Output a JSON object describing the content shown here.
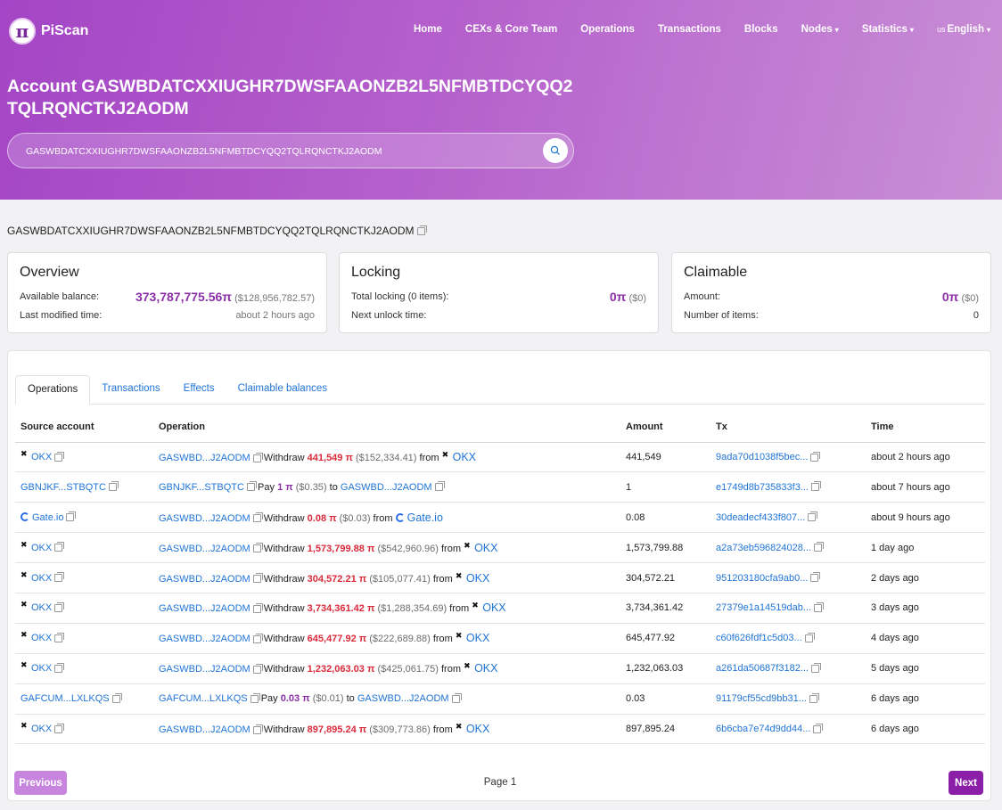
{
  "header": {
    "logo_symbol": "π",
    "logo_text": "PiScan",
    "nav": [
      {
        "label": "Home",
        "caret": ""
      },
      {
        "label": "CEXs & Core Team",
        "caret": ""
      },
      {
        "label": "Operations",
        "caret": ""
      },
      {
        "label": "Transactions",
        "caret": ""
      },
      {
        "label": "Blocks",
        "caret": ""
      },
      {
        "label": "Nodes",
        "caret": "▾"
      },
      {
        "label": "Statistics",
        "caret": "▾"
      },
      {
        "label": "English",
        "flag": "us",
        "caret": "▾"
      }
    ],
    "title": "Account GASWBDATCXXIUGHR7DWSFAAONZB2L5NFMBTDCYQQ2TQLRQNCTKJ2AODM",
    "search_value": "GASWBDATCXXIUGHR7DWSFAAONZB2L5NFMBTDCYQQ2TQLRQNCTKJ2AODM"
  },
  "account_address": "GASWBDATCXXIUGHR7DWSFAAONZB2L5NFMBTDCYQQ2TQLRQNCTKJ2AODM",
  "overview": {
    "title": "Overview",
    "balance_label": "Available balance:",
    "balance": "373,787,775.56π",
    "balance_usd": "($128,956,782.57)",
    "modified_label": "Last modified time:",
    "modified": "about 2 hours ago"
  },
  "locking": {
    "title": "Locking",
    "total_label": "Total locking (0 items):",
    "total": "0π",
    "total_usd": "($0)",
    "unlock_label": "Next unlock time:",
    "unlock": ""
  },
  "claimable": {
    "title": "Claimable",
    "amount_label": "Amount:",
    "amount": "0π",
    "amount_usd": "($0)",
    "items_label": "Number of items:",
    "items": "0"
  },
  "tabs": [
    "Operations",
    "Transactions",
    "Effects",
    "Claimable balances"
  ],
  "table": {
    "headers": [
      "Source account",
      "Operation",
      "Amount",
      "Tx",
      "Time"
    ],
    "rows": [
      {
        "source": "OKX",
        "op_src": "GASWBD...J2AODM",
        "verb": "Withdraw",
        "amt": "441,549",
        "usd": "($152,334.41)",
        "prep": "from",
        "target": "OKX",
        "amount": "441,549",
        "tx": "9ada70d1038f5bec...",
        "time": "about 2 hours ago"
      },
      {
        "source": "GBNJKF...STBQTC",
        "op_src": "GBNJKF...STBQTC",
        "verb": "Pay",
        "amt": "1",
        "usd": "($0.35)",
        "prep": "to",
        "target": "GASWBD...J2AODM",
        "amount": "1",
        "tx": "e1749d8b735833f3...",
        "time": "about 7 hours ago"
      },
      {
        "source": "Gate.io",
        "op_src": "GASWBD...J2AODM",
        "verb": "Withdraw",
        "amt": "0.08",
        "usd": "($0.03)",
        "prep": "from",
        "target": "Gate.io",
        "amount": "0.08",
        "tx": "30deadecf433f807...",
        "time": "about 9 hours ago"
      },
      {
        "source": "OKX",
        "op_src": "GASWBD...J2AODM",
        "verb": "Withdraw",
        "amt": "1,573,799.88",
        "usd": "($542,960.96)",
        "prep": "from",
        "target": "OKX",
        "amount": "1,573,799.88",
        "tx": "a2a73eb596824028...",
        "time": "1 day ago"
      },
      {
        "source": "OKX",
        "op_src": "GASWBD...J2AODM",
        "verb": "Withdraw",
        "amt": "304,572.21",
        "usd": "($105,077.41)",
        "prep": "from",
        "target": "OKX",
        "amount": "304,572.21",
        "tx": "951203180cfa9ab0...",
        "time": "2 days ago"
      },
      {
        "source": "OKX",
        "op_src": "GASWBD...J2AODM",
        "verb": "Withdraw",
        "amt": "3,734,361.42",
        "usd": "($1,288,354.69)",
        "prep": "from",
        "target": "OKX",
        "amount": "3,734,361.42",
        "tx": "27379e1a14519dab...",
        "time": "3 days ago"
      },
      {
        "source": "OKX",
        "op_src": "GASWBD...J2AODM",
        "verb": "Withdraw",
        "amt": "645,477.92",
        "usd": "($222,689.88)",
        "prep": "from",
        "target": "OKX",
        "amount": "645,477.92",
        "tx": "c60f626fdf1c5d03...",
        "time": "4 days ago"
      },
      {
        "source": "OKX",
        "op_src": "GASWBD...J2AODM",
        "verb": "Withdraw",
        "amt": "1,232,063.03",
        "usd": "($425,061.75)",
        "prep": "from",
        "target": "OKX",
        "amount": "1,232,063.03",
        "tx": "a261da50687f3182...",
        "time": "5 days ago"
      },
      {
        "source": "GAFCUM...LXLKQS",
        "op_src": "GAFCUM...LXLKQS",
        "verb": "Pay",
        "amt": "0.03",
        "usd": "($0.01)",
        "prep": "to",
        "target": "GASWBD...J2AODM",
        "amount": "0.03",
        "tx": "91179cf55cd9bb31...",
        "time": "6 days ago"
      },
      {
        "source": "OKX",
        "op_src": "GASWBD...J2AODM",
        "verb": "Withdraw",
        "amt": "897,895.24",
        "usd": "($309,773.86)",
        "prep": "from",
        "target": "OKX",
        "amount": "897,895.24",
        "tx": "6b6cba7e74d9dd44...",
        "time": "6 days ago"
      }
    ]
  },
  "pagination": {
    "prev": "Previous",
    "page": "Page 1",
    "next": "Next"
  },
  "colors": {
    "brand": "#a445c5",
    "link": "#1f74d6",
    "withdraw": "#d92a3a",
    "pay": "#8b2fa6"
  }
}
